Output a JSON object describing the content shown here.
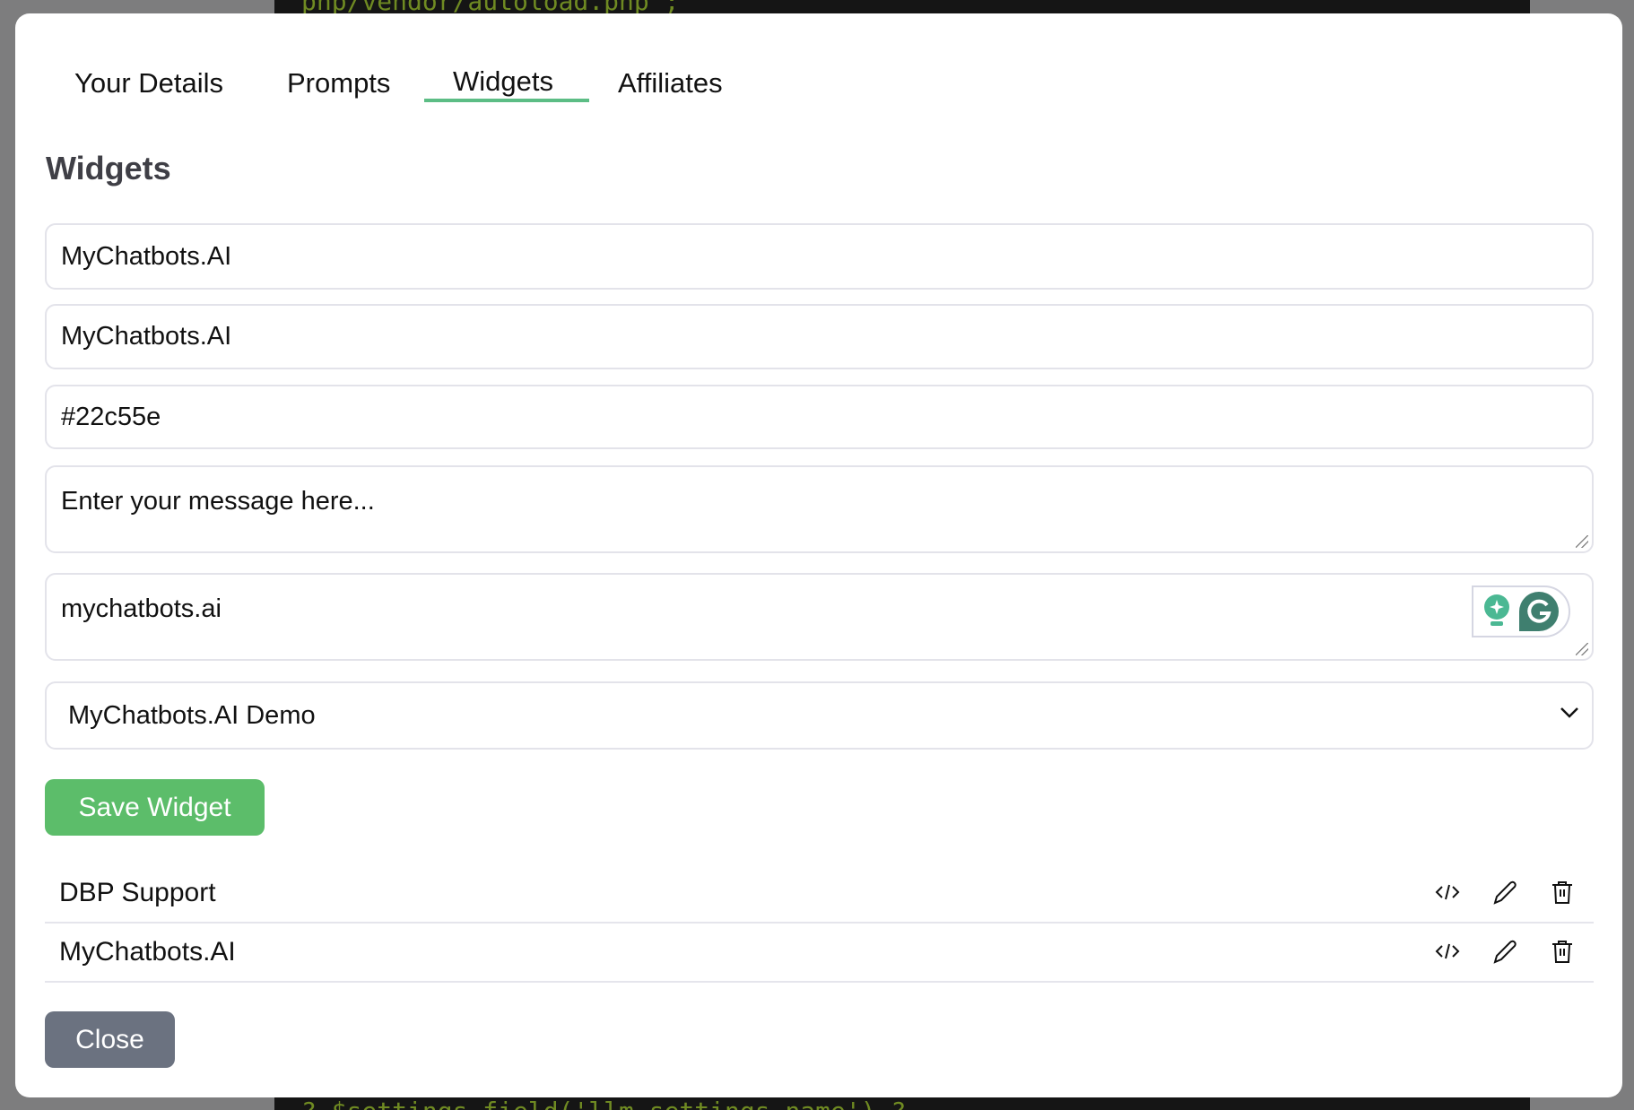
{
  "background": {
    "code_top": "php/vendor/autoload.php';",
    "code_bottom": "? $settings_field('llm_settings_name') ?"
  },
  "tabs": [
    {
      "label": "Your Details",
      "active": false
    },
    {
      "label": "Prompts",
      "active": false
    },
    {
      "label": "Widgets",
      "active": true
    },
    {
      "label": "Affiliates",
      "active": false
    }
  ],
  "accent_color": "#5cbd85",
  "heading": "Widgets",
  "form": {
    "name_value": "MyChatbots.AI",
    "title_value": "MyChatbots.AI",
    "color_value": "#22c55e",
    "message_placeholder": "Enter your message here...",
    "domain_value": "mychatbots.ai",
    "bot_select_value": "MyChatbots.AI Demo",
    "save_label": "Save Widget"
  },
  "widgets": [
    {
      "name": "DBP Support"
    },
    {
      "name": "MyChatbots.AI"
    }
  ],
  "close_label": "Close"
}
